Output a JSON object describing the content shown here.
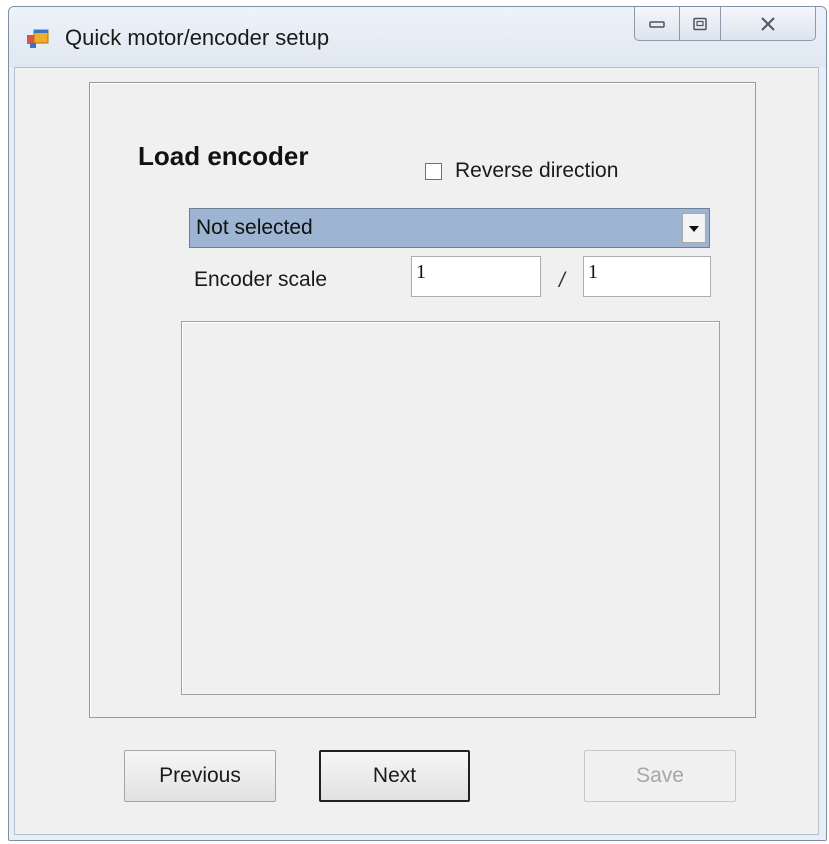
{
  "window": {
    "title": "Quick motor/encoder setup",
    "icon": "app-window-icon",
    "controls": [
      "minimize-icon",
      "restore-icon",
      "close-icon"
    ]
  },
  "panel": {
    "heading": "Load encoder",
    "reverse_direction": {
      "label": "Reverse direction",
      "checked": false
    },
    "encoder_select": {
      "value": "Not selected",
      "icon": "dropdown-arrow-icon"
    },
    "encoder_scale": {
      "label": "Encoder scale",
      "numerator": "1",
      "separator": "/",
      "denominator": "1"
    }
  },
  "buttons": {
    "previous": "Previous",
    "next": "Next",
    "save": "Save"
  },
  "colors": {
    "select_highlight": "#9db4d2",
    "disabled_text": "#a6a6a6"
  }
}
